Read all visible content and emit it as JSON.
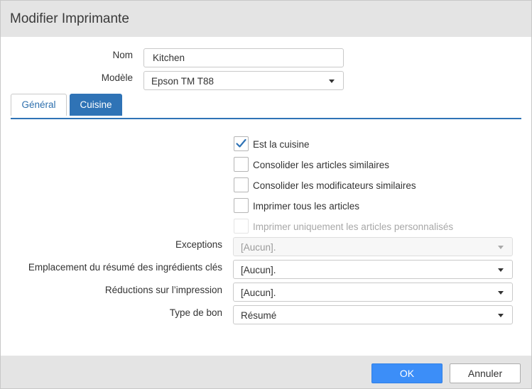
{
  "dialog": {
    "title": "Modifier Imprimante"
  },
  "fields": {
    "nom": {
      "label": "Nom",
      "value": "Kitchen"
    },
    "modele": {
      "label": "Modèle",
      "value": "Epson TM T88"
    }
  },
  "tabs": [
    {
      "label": "Général",
      "active": false
    },
    {
      "label": "Cuisine",
      "active": true
    }
  ],
  "checkboxes": [
    {
      "label": "Est la cuisine",
      "checked": true,
      "disabled": false
    },
    {
      "label": "Consolider les articles similaires",
      "checked": false,
      "disabled": false
    },
    {
      "label": "Consolider les modificateurs similaires",
      "checked": false,
      "disabled": false
    },
    {
      "label": "Imprimer tous les articles",
      "checked": false,
      "disabled": false
    },
    {
      "label": "Imprimer uniquement les articles personnalisés",
      "checked": false,
      "disabled": true
    }
  ],
  "dropdowns": {
    "exceptions": {
      "label": "Exceptions",
      "value": "[Aucun].",
      "disabled": true
    },
    "emplacement": {
      "label": "Emplacement du résumé des ingrédients clés",
      "value": "[Aucun].",
      "disabled": false
    },
    "reductions": {
      "label": "Réductions sur l’impression",
      "value": "[Aucun].",
      "disabled": false
    },
    "type_bon": {
      "label": "Type de bon",
      "value": "Résumé",
      "disabled": false
    }
  },
  "footer": {
    "ok_label": "OK",
    "cancel_label": "Annuler"
  },
  "colors": {
    "accent": "#2f73b6",
    "ok_button": "#3c8ef8",
    "title_bar": "#e4e4e4",
    "check_mark": "#2f73b6"
  }
}
